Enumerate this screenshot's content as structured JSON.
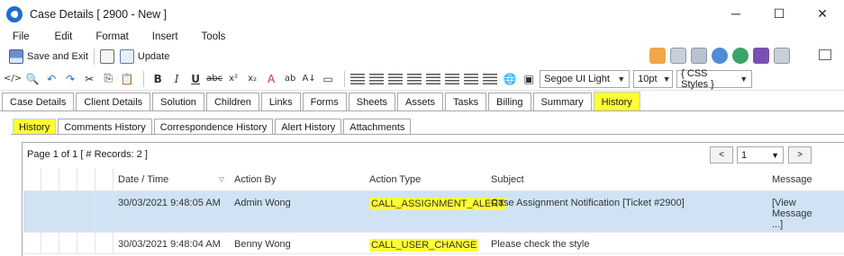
{
  "window": {
    "title": "Case Details [ 2900 - New ]",
    "controls": {
      "minimize": "─",
      "maximize": "☐",
      "close": "✕"
    }
  },
  "menu": [
    "File",
    "Edit",
    "Format",
    "Insert",
    "Tools"
  ],
  "toolbar": {
    "save_exit_label": "Save and Exit",
    "update_label": "Update"
  },
  "format_toolbar": {
    "font": "Segoe UI Light",
    "size": "10pt",
    "css_styles": "{ CSS Styles }"
  },
  "tabs": [
    "Case Details",
    "Client Details",
    "Solution",
    "Children",
    "Links",
    "Forms",
    "Sheets",
    "Assets",
    "Tasks",
    "Billing",
    "Summary",
    "History"
  ],
  "active_tab": "History",
  "subtabs": [
    "History",
    "Comments History",
    "Correspondence History",
    "Alert History",
    "Attachments"
  ],
  "active_subtab": "History",
  "pager": {
    "info": "Page 1 of 1 [ # Records: 2 ]",
    "prev": "<",
    "page": "1",
    "next": ">"
  },
  "columns": {
    "date": "Date / Time",
    "by": "Action By",
    "type": "Action Type",
    "subject": "Subject",
    "message": "Message"
  },
  "rows": [
    {
      "date": "30/03/2021 9:48:05 AM",
      "by": "Admin Wong",
      "type": "CALL_ASSIGNMENT_ALERT",
      "subject": "Case Assignment Notification [Ticket #2900]",
      "message": "[View Message ...]",
      "selected": true
    },
    {
      "date": "30/03/2021 9:48:04 AM",
      "by": "Benny Wong",
      "type": "CALL_USER_CHANGE",
      "subject": "Please check the style",
      "message": "",
      "selected": false
    }
  ],
  "colors": {
    "highlight": "#ffff33",
    "selected_row": "#cfe3f5",
    "app_icon": "#1f6fd1"
  }
}
